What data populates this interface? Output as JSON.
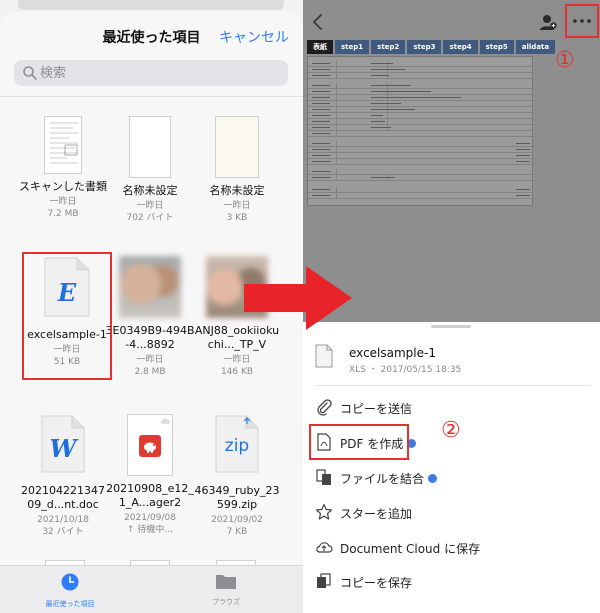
{
  "left": {
    "title": "最近使った項目",
    "cancel_label": "キャンセル",
    "search_placeholder": "検索",
    "files": [
      {
        "name": "スキャンした書類",
        "date": "一昨日",
        "size": "7.2 MB",
        "kind": "scan"
      },
      {
        "name": "名称未設定",
        "date": "一昨日",
        "size": "702 バイト",
        "kind": "blank"
      },
      {
        "name": "名称未設定",
        "date": "一昨日",
        "size": "3 KB",
        "kind": "blank"
      },
      {
        "name": "excelsample-1",
        "date": "一昨日",
        "size": "51 KB",
        "kind": "excel",
        "glyph": "E"
      },
      {
        "name": "3E0349B9-494B-4...8892",
        "date": "一昨日",
        "size": "2.8 MB",
        "kind": "photo"
      },
      {
        "name": "ANJ88_ookiiokuchi..._TP_V",
        "date": "一昨日",
        "size": "146 KB",
        "kind": "photo"
      },
      {
        "name": "20210422134709_d...nt.doc",
        "date": "2021/10/18",
        "size": "32 バイト",
        "kind": "word",
        "glyph": "W"
      },
      {
        "name": "20210908_e12_1_A...ager2",
        "date": "2021/09/08",
        "size": "↑ 待機中...",
        "kind": "pdf"
      },
      {
        "name": "46349_ruby_23599.zip",
        "date": "2021/09/02",
        "size": "7 KB",
        "kind": "zip",
        "glyph": "zip"
      }
    ],
    "tabs": [
      {
        "label": "最近使った項目",
        "active": true
      },
      {
        "label": "ブラウズ",
        "active": false
      }
    ]
  },
  "right": {
    "annotation_1": "①",
    "annotation_2": "②",
    "sheet_tabs": [
      "表紙",
      "step1",
      "step2",
      "step3",
      "step4",
      "step5",
      "alldata"
    ],
    "file_name": "excelsample-1",
    "file_meta": "XLS ・ 2017/05/15 18:35",
    "menu": [
      {
        "label": "コピーを送信",
        "icon": "paperclip-icon",
        "premium": false
      },
      {
        "label": "PDF を作成",
        "icon": "pdf-icon",
        "premium": true
      },
      {
        "label": "ファイルを結合",
        "icon": "combine-icon",
        "premium": true
      },
      {
        "label": "スターを追加",
        "icon": "star-icon",
        "premium": false
      },
      {
        "label": "Document Cloud に保存",
        "icon": "cloud-upload-icon",
        "premium": false
      },
      {
        "label": "コピーを保存",
        "icon": "copy-icon",
        "premium": false
      }
    ]
  },
  "colors": {
    "accent_blue": "#2f7cf6",
    "highlight_red": "#e53030",
    "premium_blue": "#3d7be0"
  }
}
